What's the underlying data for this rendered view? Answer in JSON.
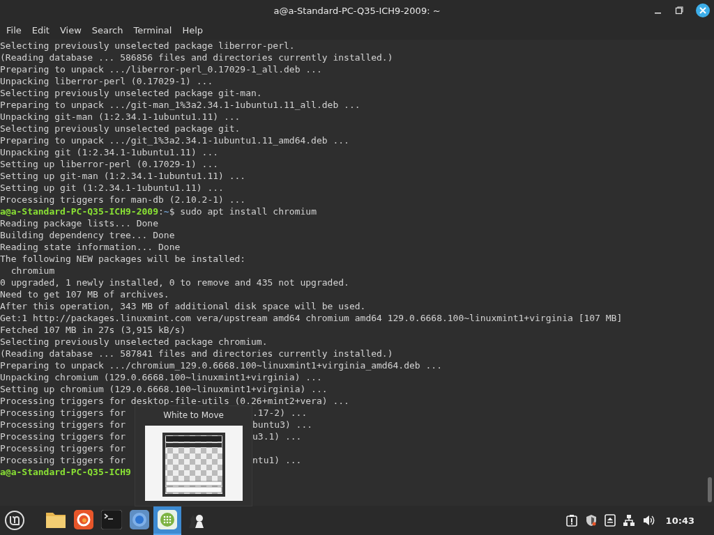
{
  "window": {
    "title": "a@a-Standard-PC-Q35-ICH9-2009: ~"
  },
  "menu": [
    "File",
    "Edit",
    "View",
    "Search",
    "Terminal",
    "Help"
  ],
  "terminal": {
    "lines": [
      {
        "kind": "output",
        "text": "Selecting previously unselected package liberror-perl."
      },
      {
        "kind": "output",
        "text": "(Reading database ... 586856 files and directories currently installed.)"
      },
      {
        "kind": "output",
        "text": "Preparing to unpack .../liberror-perl_0.17029-1_all.deb ..."
      },
      {
        "kind": "output",
        "text": "Unpacking liberror-perl (0.17029-1) ..."
      },
      {
        "kind": "output",
        "text": "Selecting previously unselected package git-man."
      },
      {
        "kind": "output",
        "text": "Preparing to unpack .../git-man_1%3a2.34.1-1ubuntu1.11_all.deb ..."
      },
      {
        "kind": "output",
        "text": "Unpacking git-man (1:2.34.1-1ubuntu1.11) ..."
      },
      {
        "kind": "output",
        "text": "Selecting previously unselected package git."
      },
      {
        "kind": "output",
        "text": "Preparing to unpack .../git_1%3a2.34.1-1ubuntu1.11_amd64.deb ..."
      },
      {
        "kind": "output",
        "text": "Unpacking git (1:2.34.1-1ubuntu1.11) ..."
      },
      {
        "kind": "output",
        "text": "Setting up liberror-perl (0.17029-1) ..."
      },
      {
        "kind": "output",
        "text": "Setting up git-man (1:2.34.1-1ubuntu1.11) ..."
      },
      {
        "kind": "output",
        "text": "Setting up git (1:2.34.1-1ubuntu1.11) ..."
      },
      {
        "kind": "output",
        "text": "Processing triggers for man-db (2.10.2-1) ..."
      },
      {
        "kind": "prompt",
        "user": "a@a-Standard-PC-Q35-ICH9-2009",
        "sep": ":",
        "path": "~",
        "command": "$ sudo apt install chromium"
      },
      {
        "kind": "output",
        "text": "Reading package lists... Done"
      },
      {
        "kind": "output",
        "text": "Building dependency tree... Done"
      },
      {
        "kind": "output",
        "text": "Reading state information... Done"
      },
      {
        "kind": "output",
        "text": "The following NEW packages will be installed:"
      },
      {
        "kind": "output",
        "text": "  chromium"
      },
      {
        "kind": "output",
        "text": "0 upgraded, 1 newly installed, 0 to remove and 435 not upgraded."
      },
      {
        "kind": "output",
        "text": "Need to get 107 MB of archives."
      },
      {
        "kind": "output",
        "text": "After this operation, 343 MB of additional disk space will be used."
      },
      {
        "kind": "output",
        "text": "Get:1 http://packages.linuxmint.com vera/upstream amd64 chromium amd64 129.0.6668.100~linuxmint1+virginia [107 MB]"
      },
      {
        "kind": "output",
        "text": "Fetched 107 MB in 27s (3,915 kB/s)"
      },
      {
        "kind": "output",
        "text": "Selecting previously unselected package chromium."
      },
      {
        "kind": "output",
        "text": "(Reading database ... 587841 files and directories currently installed.)"
      },
      {
        "kind": "output",
        "text": "Preparing to unpack .../chromium_129.0.6668.100~linuxmint1+virginia_amd64.deb ..."
      },
      {
        "kind": "output",
        "text": "Unpacking chromium (129.0.6668.100~linuxmint1+virginia) ..."
      },
      {
        "kind": "output",
        "text": "Setting up chromium (129.0.6668.100~linuxmint1+virginia) ..."
      },
      {
        "kind": "output",
        "text": "Processing triggers for desktop-file-utils (0.26+mint2+vera) ..."
      },
      {
        "kind": "covered",
        "text": "Processing triggers for",
        "tail": ".17-2) ..."
      },
      {
        "kind": "covered",
        "text": "Processing triggers for",
        "tail": "buntu3) ..."
      },
      {
        "kind": "covered",
        "text": "Processing triggers for",
        "tail": "u3.1) ..."
      },
      {
        "kind": "covered",
        "text": "Processing triggers for"
      },
      {
        "kind": "covered",
        "text": "Processing triggers for",
        "tail": "ntu1) ..."
      },
      {
        "kind": "prompt",
        "user": "a@a-Standard-PC-Q35-ICH9"
      }
    ]
  },
  "window_preview": {
    "title": "White to Move",
    "kind": "picture"
  },
  "taskbar": {
    "apps": [
      {
        "kind": "files",
        "selected": false
      },
      {
        "kind": "browser",
        "selected": false
      },
      {
        "kind": "terminal",
        "selected": false
      },
      {
        "kind": "chromium",
        "selected": false
      },
      {
        "kind": "apps",
        "selected": true
      },
      {
        "kind": "chess",
        "selected": false
      }
    ],
    "clock": "10:43"
  }
}
